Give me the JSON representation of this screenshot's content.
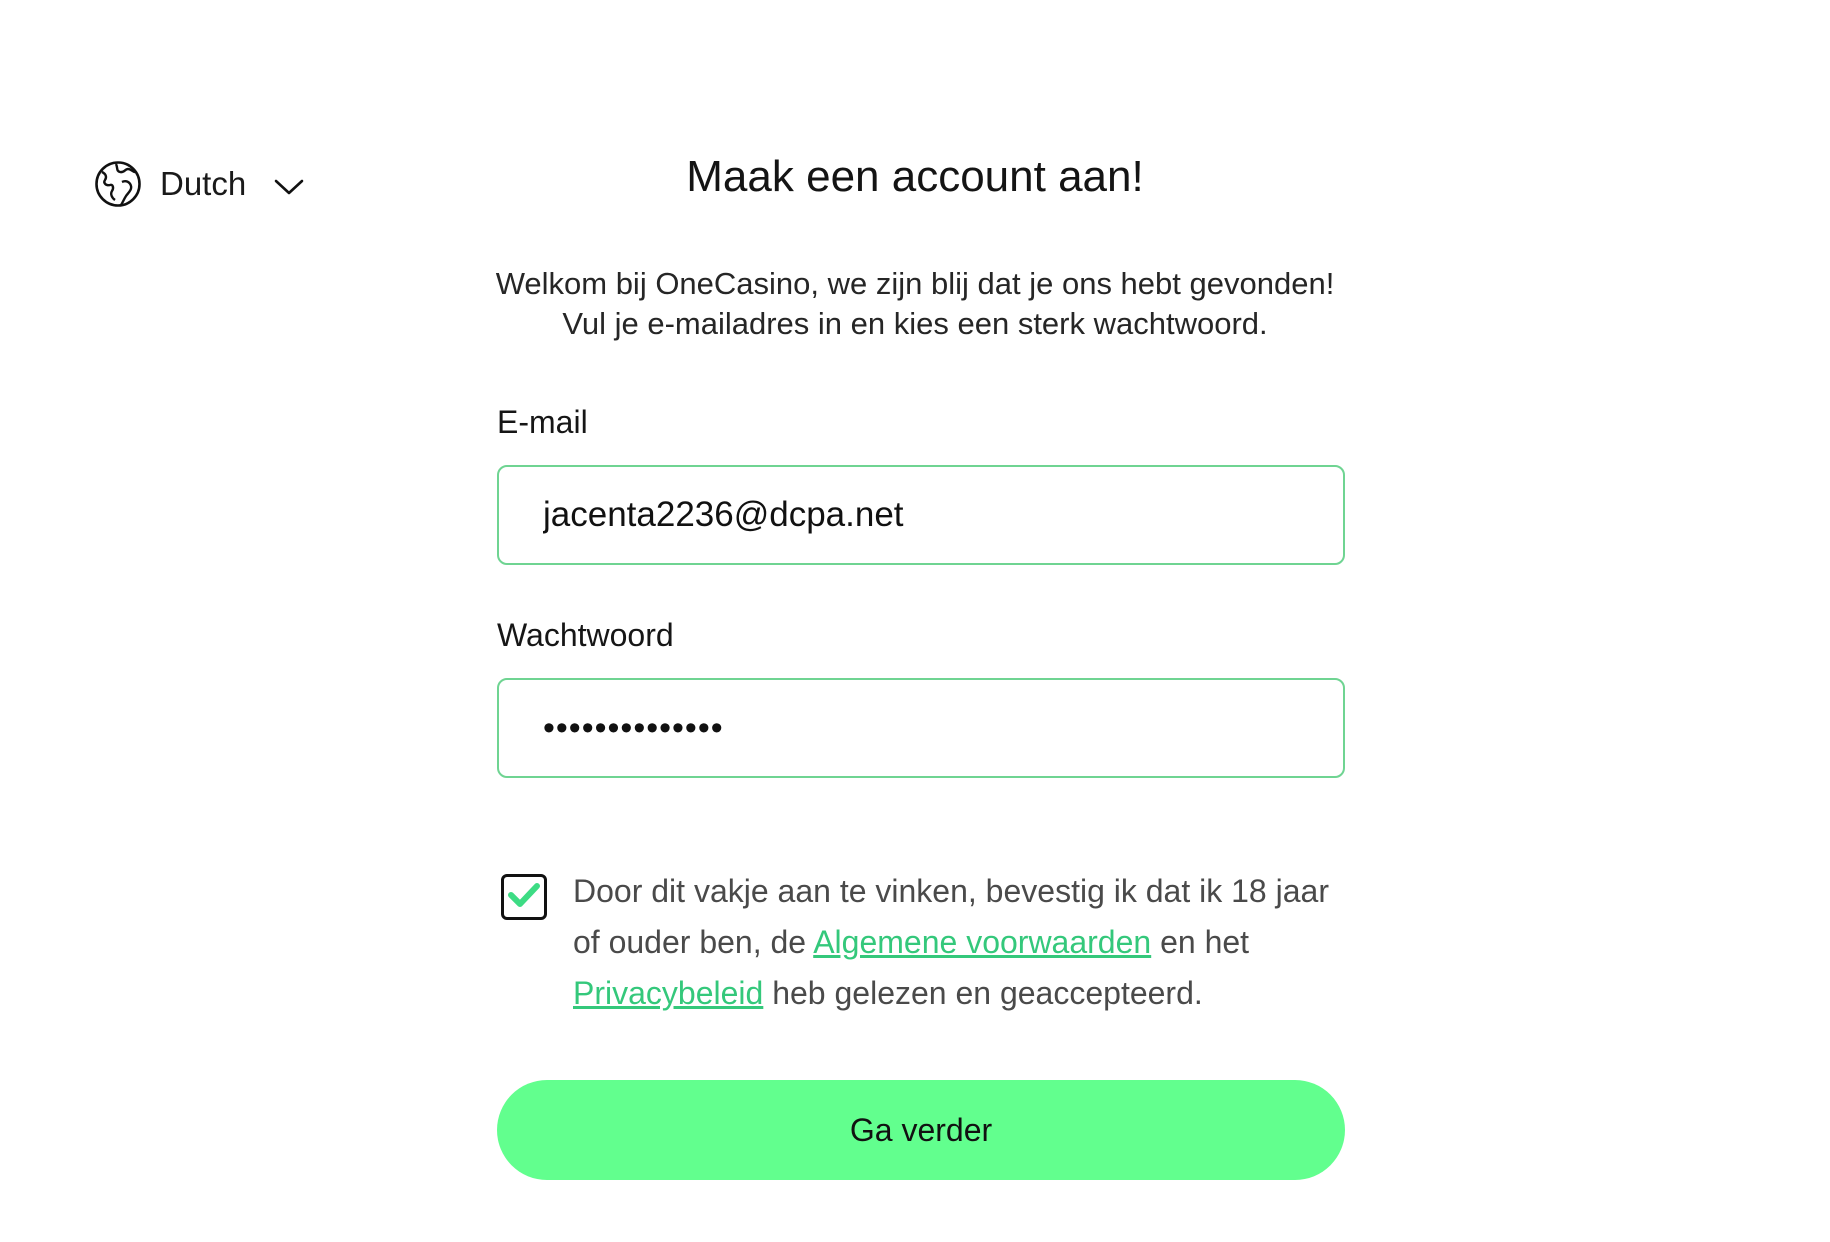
{
  "language": {
    "label": "Dutch",
    "icon": "globe-icon",
    "chevron": "chevron-down-icon"
  },
  "heading": {
    "title": "Maak een account aan!",
    "line1": "Welkom bij OneCasino, we zijn blij dat je ons hebt gevonden!",
    "line2": "Vul je e-mailadres in en kies een sterk wachtwoord."
  },
  "form": {
    "email_label": "E-mail",
    "email_value": "jacenta2236@dcpa.net",
    "password_label": "Wachtwoord",
    "password_value": "••••••••••••••"
  },
  "consent": {
    "checked": true,
    "text_before": "Door dit vakje aan te vinken, bevestig ik dat ik 18 jaar of ouder ben, de ",
    "terms_link": "Algemene voorwaarden",
    "text_middle": " en het ",
    "privacy_link": "Privacybeleid",
    "text_after": " heb gelezen en geaccepteerd."
  },
  "submit": {
    "label": "Ga verder"
  },
  "colors": {
    "accent": "#62ff8e",
    "input_border": "#6fd492",
    "link": "#34c87b",
    "check": "#3ddc84"
  }
}
